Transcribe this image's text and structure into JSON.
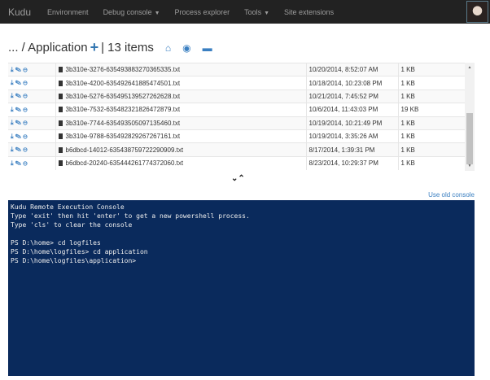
{
  "nav": {
    "brand": "Kudu",
    "items": [
      "Environment",
      "Debug console",
      "Process explorer",
      "Tools",
      "Site extensions"
    ]
  },
  "header": {
    "breadcrumb": "... / Application",
    "count": "| 13 items"
  },
  "files": [
    {
      "name": "3b310e-3276-635493883270365335.txt",
      "date": "10/20/2014, 8:52:07 AM",
      "size": "1 KB"
    },
    {
      "name": "3b310e-4200-635492641885474501.txt",
      "date": "10/18/2014, 10:23:08 PM",
      "size": "1 KB"
    },
    {
      "name": "3b310e-5276-635495139527262628.txt",
      "date": "10/21/2014, 7:45:52 PM",
      "size": "1 KB"
    },
    {
      "name": "3b310e-7532-635482321826472879.txt",
      "date": "10/6/2014, 11:43:03 PM",
      "size": "19 KB"
    },
    {
      "name": "3b310e-7744-635493505097135460.txt",
      "date": "10/19/2014, 10:21:49 PM",
      "size": "1 KB"
    },
    {
      "name": "3b310e-9788-635492829267267161.txt",
      "date": "10/19/2014, 3:35:26 AM",
      "size": "1 KB"
    },
    {
      "name": "b6dbcd-14012-635438759722290909.txt",
      "date": "8/17/2014, 1:39:31 PM",
      "size": "1 KB"
    },
    {
      "name": "b6dbcd-20240-635444261774372060.txt",
      "date": "8/23/2014, 10:29:37 PM",
      "size": "1 KB"
    }
  ],
  "console": {
    "old_link": "Use old console",
    "lines": [
      "Kudu Remote Execution Console",
      "Type 'exit' then hit 'enter' to get a new powershell process.",
      "Type 'cls' to clear the console",
      "",
      "PS D:\\home> cd logfiles",
      "PS D:\\home\\logfiles> cd application",
      "PS D:\\home\\logfiles\\application>"
    ]
  }
}
